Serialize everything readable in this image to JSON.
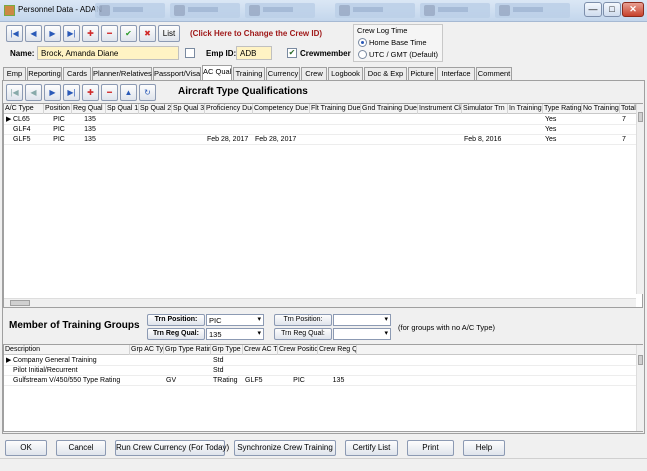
{
  "window": {
    "title": "Personnel Data - ADAN",
    "min": "—",
    "max": "□",
    "close": "✕"
  },
  "toolbar": {
    "first": "|◀",
    "prev": "◀",
    "next": "▶",
    "last": "▶|",
    "add": "✚",
    "remove": "━",
    "save": "✔",
    "cancel": "✖",
    "list_label": "List",
    "hint": "(Click Here to Change the Crew ID)"
  },
  "crew": {
    "name_label": "Name:",
    "name_value": "Brock, Amanda Diane",
    "emp_label": "Emp ID:",
    "emp_value": "ADB",
    "crewmember_label": "Crewmember",
    "crewmember_checked": "✔"
  },
  "log_time": {
    "title": "Crew Log Time",
    "option1": "Home Base Time",
    "option2": "UTC / GMT (Default)"
  },
  "tabs": [
    "Emp",
    "Reporting",
    "Cards",
    "Planner/Relatives",
    "Passport/Visa",
    "AC Qual",
    "Training",
    "Currency",
    "Crew",
    "Logbook",
    "Doc & Exp",
    "Picture",
    "Interface",
    "Comment"
  ],
  "aircraft_section": {
    "title": "Aircraft Type Qualifications",
    "columns": [
      "A/C Type",
      "Position",
      "Reg Qual",
      "Sp Qual 1",
      "Sp Qual 2",
      "Sp Qual 3",
      "Proficiency Due",
      "Competency Due",
      "Flt Training Due",
      "Gnd Training Due",
      "Instrument Ck",
      "Simulator Trn",
      "In Training",
      "Type Rating",
      "No Training",
      "Total T"
    ],
    "rows": [
      {
        "marker": "▶",
        "cells": [
          "CL65",
          "PIC",
          "135",
          "",
          "",
          "",
          "",
          "",
          "",
          "",
          "",
          "",
          "",
          "Yes",
          "",
          "7"
        ]
      },
      {
        "marker": "",
        "cells": [
          "GLF4",
          "PIC",
          "135",
          "",
          "",
          "",
          "",
          "",
          "",
          "",
          "",
          "",
          "",
          "Yes",
          "",
          ""
        ]
      },
      {
        "marker": "",
        "cells": [
          "GLF5",
          "PIC",
          "135",
          "",
          "",
          "",
          "Feb 28, 2017",
          "Feb 28, 2017",
          "",
          "",
          "",
          "Feb 8, 2016",
          "",
          "Yes",
          "",
          "7"
        ]
      }
    ]
  },
  "training_section": {
    "title": "Member of Training Groups",
    "trn_position_label": "Trn Position:",
    "trn_position_value": "PIC",
    "trn_reg_label": "Trn Reg Qual:",
    "trn_reg_value": "135",
    "trn_position2_label": "Trn Position:",
    "trn_position2_value": "",
    "trn_reg2_label": "Trn Reg Qual:",
    "trn_reg2_value": "",
    "note": "(for groups with no A/C Type)",
    "columns": [
      "Description",
      "Grp AC Type",
      "Grp Type Rating",
      "Grp Type",
      "Crew AC Type",
      "Crew Position",
      "Crew Reg Qual"
    ],
    "rows": [
      {
        "marker": "▶",
        "cells": [
          "Company General Training",
          "",
          "",
          "Std",
          "",
          "",
          ""
        ]
      },
      {
        "marker": "",
        "cells": [
          "Pilot Initial/Recurrent",
          "",
          "",
          "Std",
          "",
          "",
          ""
        ]
      },
      {
        "marker": "",
        "cells": [
          "Gulfstream V/450/550 Type Rating",
          "",
          "GV",
          "TRating",
          "GLF5",
          "PIC",
          "135"
        ]
      }
    ]
  },
  "footer_buttons": [
    "OK",
    "Cancel",
    "Run Crew Currency (For Today)",
    "Synchronize Crew Training",
    "Certify List",
    "Print",
    "Help"
  ]
}
